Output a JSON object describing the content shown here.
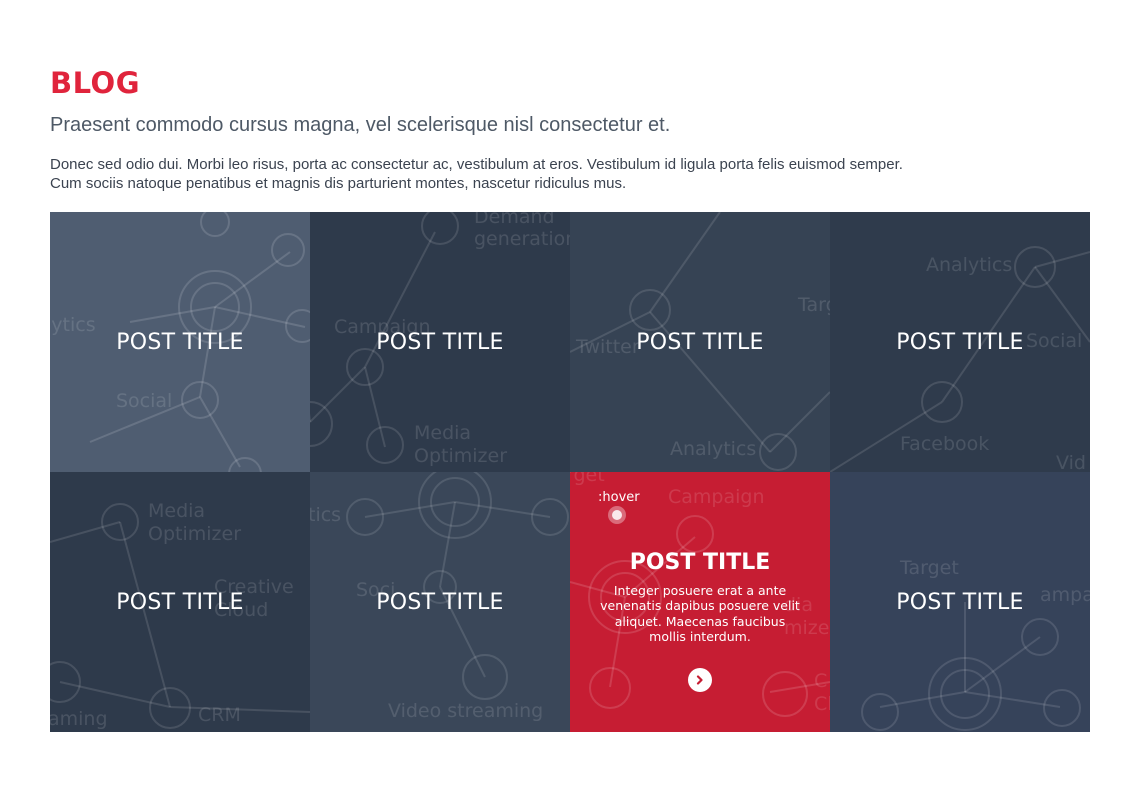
{
  "header": {
    "title": "BLOG",
    "subtitle": "Praesent commodo cursus magna, vel scelerisque nisl consectetur et.",
    "intro_line1": "Donec sed odio dui. Morbi leo risus, porta ac consectetur ac, vestibulum at eros. Vestibulum id ligula porta felis euismod semper.",
    "intro_line2": "Cum sociis natoque penatibus et magnis dis parturient montes, nascetur ridiculus mus."
  },
  "posts": [
    {
      "title": "POST TITLE",
      "bg_words": [
        "lytics",
        "Social"
      ]
    },
    {
      "title": "POST TITLE",
      "bg_words": [
        "Demand",
        "generation",
        "Campaign",
        "Media",
        "Optimizer"
      ]
    },
    {
      "title": "POST TITLE",
      "bg_words": [
        "Twitter",
        "Targ",
        "Analytics"
      ]
    },
    {
      "title": "POST TITLE",
      "bg_words": [
        "Analytics",
        "Social",
        "Facebook",
        "Vid"
      ]
    },
    {
      "title": "POST TITLE",
      "bg_words": [
        "Media",
        "Optimizer",
        "Creative",
        "Cloud",
        "aming",
        "CRM"
      ]
    },
    {
      "title": "POST TITLE",
      "bg_words": [
        "tics",
        "Soci",
        "Video streaming"
      ]
    },
    {
      "title": "POST TITLE",
      "bg_words": [
        "rget",
        "Campaign",
        "dia",
        "mize",
        "C",
        "Clic"
      ],
      "excerpt": "Integer posuere erat a ante venenatis dapibus posuere velit aliquet. Maecenas faucibus mollis interdum.",
      "state_label": ":hover",
      "icon": "chevron-right-icon"
    },
    {
      "title": "POST TITLE",
      "bg_words": [
        "Target",
        "ampaig"
      ]
    }
  ],
  "colors": {
    "accent": "#e0243c",
    "hover_tile": "#c61d33",
    "tile_dark": "#2e3a4b",
    "tile_light": "#4f5d71"
  }
}
